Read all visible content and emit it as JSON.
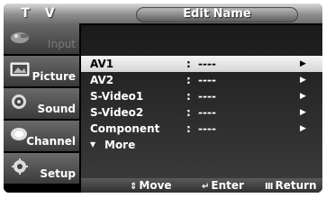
{
  "header": {
    "app_label": "T V",
    "title": "Edit Name"
  },
  "nav": {
    "items": [
      {
        "label": "Input",
        "icon": "input-icon",
        "state": "dim"
      },
      {
        "label": "Picture",
        "icon": "picture-icon",
        "state": "normal"
      },
      {
        "label": "Sound",
        "icon": "sound-icon",
        "state": "normal"
      },
      {
        "label": "Channel",
        "icon": "channel-icon",
        "state": "normal"
      },
      {
        "label": "Setup",
        "icon": "setup-icon",
        "state": "normal"
      }
    ]
  },
  "list": {
    "rows": [
      {
        "label": "AV1",
        "colon": ":",
        "value": "----",
        "arrow": "▶",
        "selected": true
      },
      {
        "label": "AV2",
        "colon": ":",
        "value": "----",
        "arrow": "▶",
        "selected": false
      },
      {
        "label": "S-Video1",
        "colon": ":",
        "value": "----",
        "arrow": "▶",
        "selected": false
      },
      {
        "label": "S-Video2",
        "colon": ":",
        "value": "----",
        "arrow": "▶",
        "selected": false
      },
      {
        "label": "Component",
        "colon": ":",
        "value": "----",
        "arrow": "▶",
        "selected": false
      }
    ],
    "more": {
      "arrow": "▼",
      "label": "More"
    }
  },
  "footer": {
    "move": {
      "icon": "⇕",
      "label": "Move"
    },
    "enter": {
      "icon": "↵",
      "label": "Enter"
    },
    "return": {
      "icon": "Ⅲ",
      "label": "Return"
    }
  },
  "colors": {
    "selected_row": "#e6e6e6",
    "panel_bg": "#2a2a2a",
    "header_bg": "#8f8f8f"
  }
}
